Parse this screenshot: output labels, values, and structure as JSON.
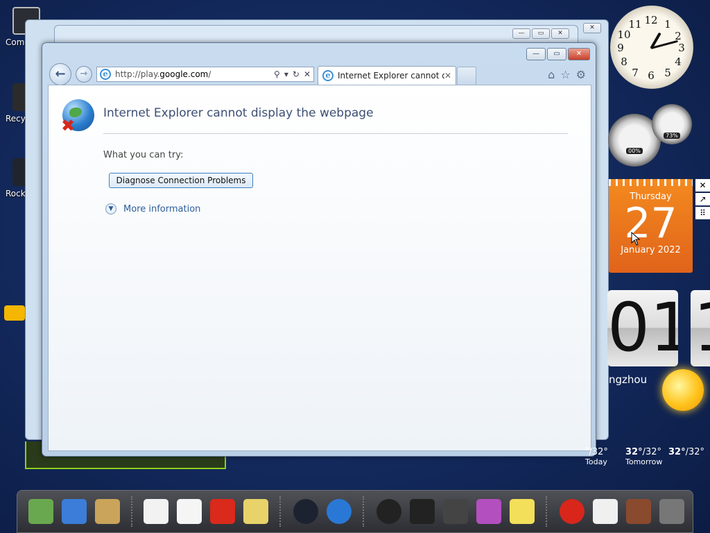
{
  "desktop": {
    "icons": [
      {
        "label": "Com"
      },
      {
        "label": "Recy"
      },
      {
        "label": "Rocke"
      }
    ]
  },
  "browser": {
    "address_prefix": "http://play.",
    "address_host": "google.com",
    "address_suffix": "/",
    "tab_title": "Internet Explorer cannot dis...",
    "error": {
      "title": "Internet Explorer cannot display the webpage",
      "what_to_try": "What you can try:",
      "diagnose_button": "Diagnose Connection Problems",
      "more_info": "More information"
    },
    "window_controls": {
      "minimize": "—",
      "restore": "▭",
      "close": "✕"
    }
  },
  "gadgets": {
    "clock_numbers": [
      "12",
      "1",
      "2",
      "3",
      "4",
      "5",
      "6",
      "7",
      "8",
      "9",
      "10",
      "11"
    ],
    "cpu_meter": "00%",
    "memory_meter": "73%",
    "calendar": {
      "day_name": "Thursday",
      "day": "27",
      "month_year": "January 2022"
    },
    "flip_clock": {
      "hour": "01",
      "minute_partial": "1"
    },
    "weather": {
      "city_partial": "ngzhou",
      "today_temp_partial": "°/32°",
      "today_label": "Today",
      "tomorrow_temp_hi": "32°",
      "tomorrow_temp_lo": "/32°",
      "tomorrow_label": "Tomorrow",
      "third_temp_hi": "32°",
      "third_temp_lo": "/32°"
    }
  },
  "dock": {
    "items": [
      {
        "icon": "android-app-icon",
        "color": "#6aa84f"
      },
      {
        "icon": "android-globe-icon",
        "color": "#3b7dd8"
      },
      {
        "icon": "folder-android-icon",
        "color": "#c9a45a"
      },
      {
        "icon": "play-store-icon",
        "color": "#f2f2f2"
      },
      {
        "icon": "gmail-icon",
        "color": "#f5f5f5"
      },
      {
        "icon": "youtube-icon",
        "color": "#d92a1c"
      },
      {
        "icon": "maps-icon",
        "color": "#e8d36a"
      },
      {
        "icon": "camera-icon",
        "color": "#1d2230"
      },
      {
        "icon": "browser-globe-icon",
        "color": "#2a78d6"
      },
      {
        "icon": "speaker-icon",
        "color": "#222"
      },
      {
        "icon": "color-tv-icon",
        "color": "#222"
      },
      {
        "icon": "calculator-icon",
        "color": "#444"
      },
      {
        "icon": "photo-frame-icon",
        "color": "#b34fbf"
      },
      {
        "icon": "notes-icon",
        "color": "#f3df5a"
      },
      {
        "icon": "angry-birds-icon",
        "color": "#d8261b"
      },
      {
        "icon": "weather-icon",
        "color": "#f0f0f0"
      },
      {
        "icon": "gingerbread-icon",
        "color": "#8a4a2d"
      },
      {
        "icon": "trash-icon",
        "color": "#777"
      }
    ]
  },
  "colors": {
    "desktop_bg": "#13295c",
    "calendar_orange": "#f07a1c",
    "link_blue": "#2d5e9a"
  }
}
